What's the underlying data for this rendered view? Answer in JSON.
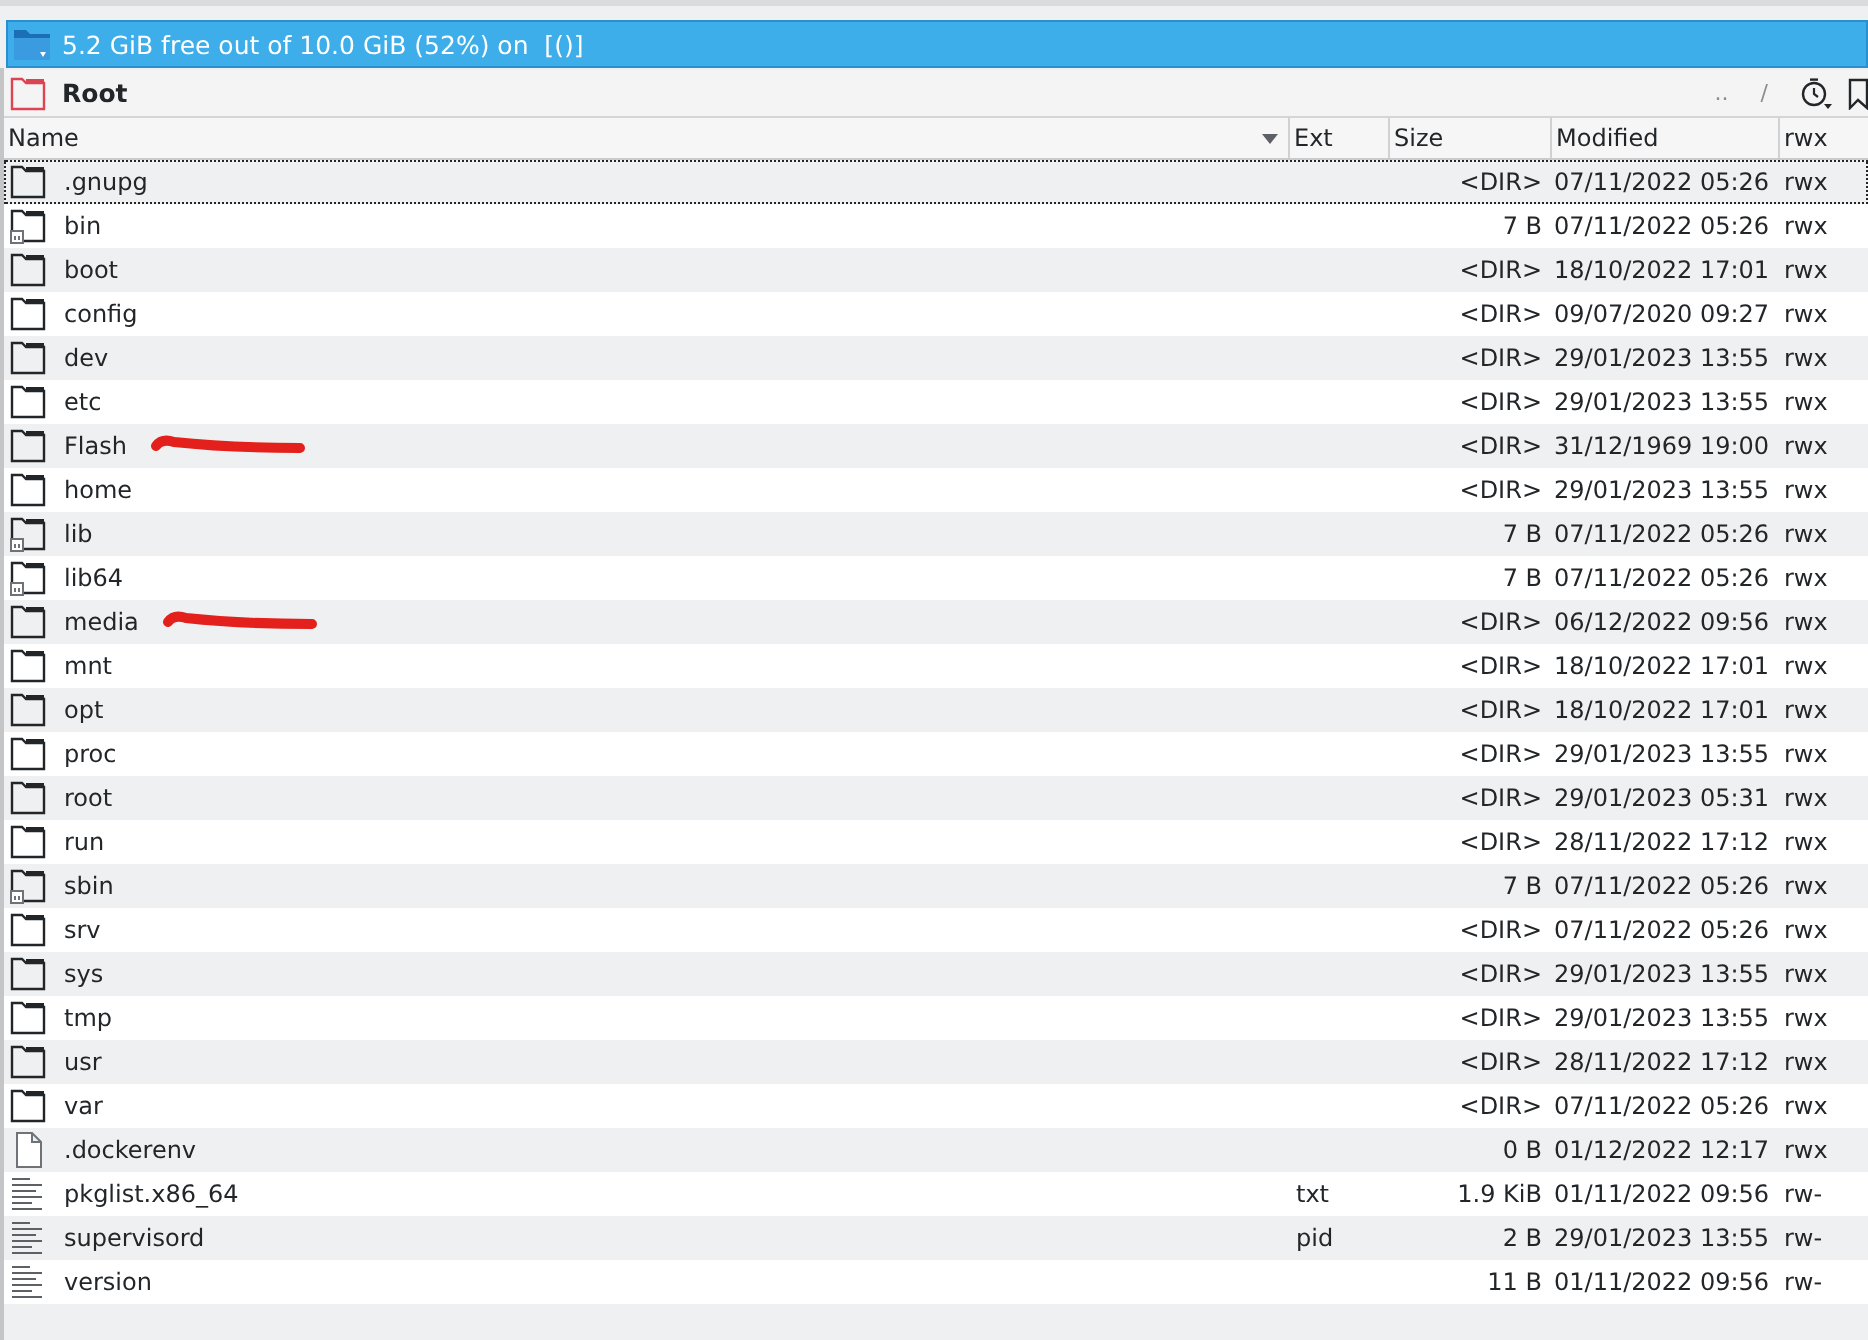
{
  "free_space_bar": {
    "text": "5.2 GiB free out of 10.0 GiB (52%) on  [()]"
  },
  "location_bar": {
    "path": "Root",
    "buttons": [
      "..",
      "/"
    ]
  },
  "table": {
    "columns": [
      {
        "label": "Name",
        "sorted": true
      },
      {
        "label": "Ext",
        "sorted": false
      },
      {
        "label": "Size",
        "sorted": false
      },
      {
        "label": "Modified",
        "sorted": false
      },
      {
        "label": "rwx",
        "sorted": false
      }
    ],
    "rows": [
      {
        "kind": "folder",
        "name": ".gnupg",
        "size": "<DIR>",
        "modified": "07/11/2022 05:26",
        "rwx": "rwx",
        "focused": true,
        "marked": false
      },
      {
        "kind": "folder-link",
        "name": "bin",
        "size": "7 B",
        "modified": "07/11/2022 05:26",
        "rwx": "rwx",
        "focused": false,
        "marked": false
      },
      {
        "kind": "folder",
        "name": "boot",
        "size": "<DIR>",
        "modified": "18/10/2022 17:01",
        "rwx": "rwx",
        "focused": false,
        "marked": false
      },
      {
        "kind": "folder",
        "name": "config",
        "size": "<DIR>",
        "modified": "09/07/2020 09:27",
        "rwx": "rwx",
        "focused": false,
        "marked": false
      },
      {
        "kind": "folder",
        "name": "dev",
        "size": "<DIR>",
        "modified": "29/01/2023 13:55",
        "rwx": "rwx",
        "focused": false,
        "marked": false
      },
      {
        "kind": "folder",
        "name": "etc",
        "size": "<DIR>",
        "modified": "29/01/2023 13:55",
        "rwx": "rwx",
        "focused": false,
        "marked": false
      },
      {
        "kind": "folder",
        "name": "Flash",
        "size": "<DIR>",
        "modified": "31/12/1969 19:00",
        "rwx": "rwx",
        "focused": false,
        "marked": true
      },
      {
        "kind": "folder",
        "name": "home",
        "size": "<DIR>",
        "modified": "29/01/2023 13:55",
        "rwx": "rwx",
        "focused": false,
        "marked": false
      },
      {
        "kind": "folder-link",
        "name": "lib",
        "size": "7 B",
        "modified": "07/11/2022 05:26",
        "rwx": "rwx",
        "focused": false,
        "marked": false
      },
      {
        "kind": "folder-link",
        "name": "lib64",
        "size": "7 B",
        "modified": "07/11/2022 05:26",
        "rwx": "rwx",
        "focused": false,
        "marked": false
      },
      {
        "kind": "folder",
        "name": "media",
        "size": "<DIR>",
        "modified": "06/12/2022 09:56",
        "rwx": "rwx",
        "focused": false,
        "marked": true
      },
      {
        "kind": "folder",
        "name": "mnt",
        "size": "<DIR>",
        "modified": "18/10/2022 17:01",
        "rwx": "rwx",
        "focused": false,
        "marked": false
      },
      {
        "kind": "folder",
        "name": "opt",
        "size": "<DIR>",
        "modified": "18/10/2022 17:01",
        "rwx": "rwx",
        "focused": false,
        "marked": false
      },
      {
        "kind": "folder",
        "name": "proc",
        "size": "<DIR>",
        "modified": "29/01/2023 13:55",
        "rwx": "rwx",
        "focused": false,
        "marked": false
      },
      {
        "kind": "folder",
        "name": "root",
        "size": "<DIR>",
        "modified": "29/01/2023 05:31",
        "rwx": "rwx",
        "focused": false,
        "marked": false
      },
      {
        "kind": "folder",
        "name": "run",
        "size": "<DIR>",
        "modified": "28/11/2022 17:12",
        "rwx": "rwx",
        "focused": false,
        "marked": false
      },
      {
        "kind": "folder-link",
        "name": "sbin",
        "size": "7 B",
        "modified": "07/11/2022 05:26",
        "rwx": "rwx",
        "focused": false,
        "marked": false
      },
      {
        "kind": "folder",
        "name": "srv",
        "size": "<DIR>",
        "modified": "07/11/2022 05:26",
        "rwx": "rwx",
        "focused": false,
        "marked": false
      },
      {
        "kind": "folder",
        "name": "sys",
        "size": "<DIR>",
        "modified": "29/01/2023 13:55",
        "rwx": "rwx",
        "focused": false,
        "marked": false
      },
      {
        "kind": "folder",
        "name": "tmp",
        "size": "<DIR>",
        "modified": "29/01/2023 13:55",
        "rwx": "rwx",
        "focused": false,
        "marked": false
      },
      {
        "kind": "folder",
        "name": "usr",
        "size": "<DIR>",
        "modified": "28/11/2022 17:12",
        "rwx": "rwx",
        "focused": false,
        "marked": false
      },
      {
        "kind": "folder",
        "name": "var",
        "size": "<DIR>",
        "modified": "07/11/2022 05:26",
        "rwx": "rwx",
        "focused": false,
        "marked": false
      },
      {
        "kind": "file",
        "name": ".dockerenv",
        "size": "0 B",
        "modified": "01/12/2022 12:17",
        "rwx": "rwx",
        "focused": false,
        "marked": false
      },
      {
        "kind": "text",
        "name": "pkglist.x86_64",
        "ext": "txt",
        "size": "1.9 KiB",
        "modified": "01/11/2022 09:56",
        "rwx": "rw-",
        "focused": false,
        "marked": false
      },
      {
        "kind": "text",
        "name": "supervisord",
        "ext": "pid",
        "size": "2 B",
        "modified": "29/01/2023 13:55",
        "rwx": "rw-",
        "focused": false,
        "marked": false
      },
      {
        "kind": "text",
        "name": "version",
        "size": "11 B",
        "modified": "01/11/2022 09:56",
        "rwx": "rw-",
        "focused": false,
        "marked": false
      }
    ]
  }
}
